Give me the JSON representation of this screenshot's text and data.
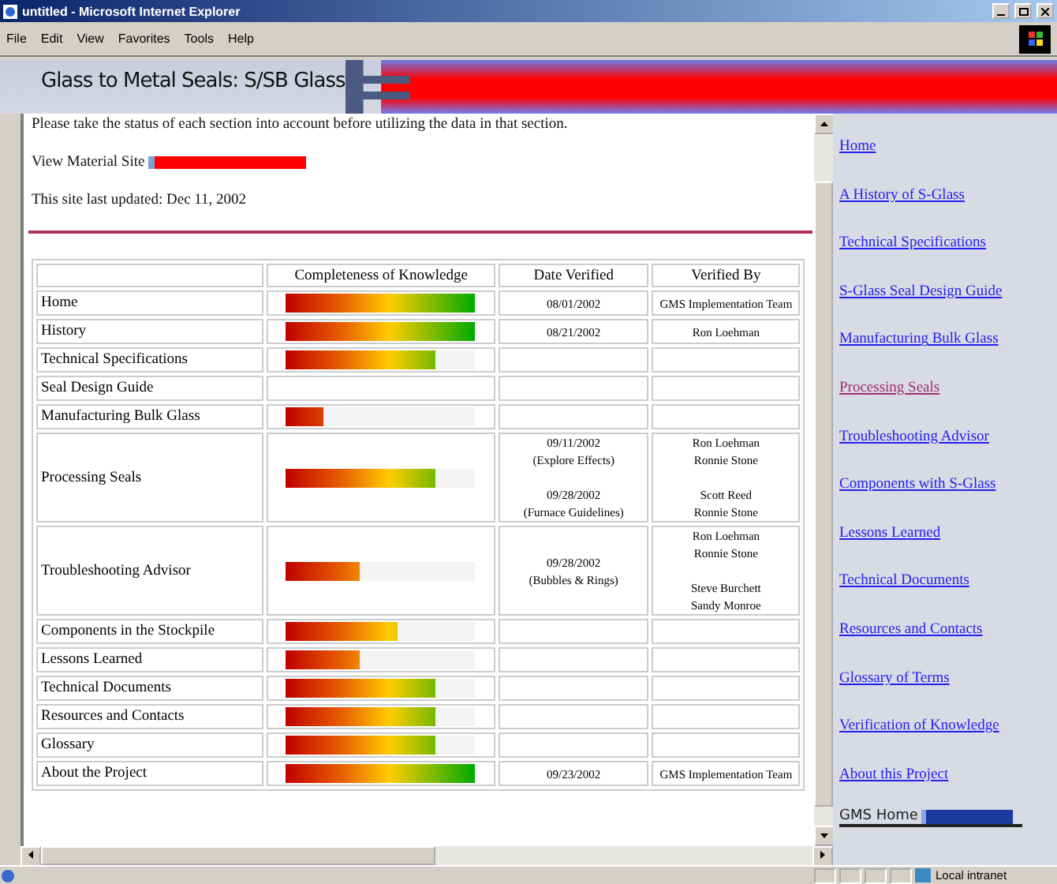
{
  "window": {
    "title": "untitled - Microsoft Internet Explorer"
  },
  "menu": [
    "File",
    "Edit",
    "View",
    "Favorites",
    "Tools",
    "Help"
  ],
  "banner": {
    "title": "Glass to Metal Seals: S/SB Glass"
  },
  "intro": [
    "Please take the status of each section into account before utilizing the data in that section.",
    "View Material Site",
    "This site last updated: Dec 11, 2002"
  ],
  "table": {
    "columns": [
      "Completeness of Knowledge",
      "Date Verified",
      "Verified By"
    ],
    "rows": [
      {
        "section": "Home",
        "level": 1,
        "dates": [
          [
            "08/01/2002"
          ]
        ],
        "verifiers": [
          [
            "GMS Implementation Team"
          ]
        ]
      },
      {
        "section": "History",
        "level": 1,
        "dates": [
          [
            "08/21/2002"
          ]
        ],
        "verifiers": [
          [
            "Ron Loehman"
          ]
        ]
      },
      {
        "section": "Technical Specifications",
        "level": 0.79,
        "dates": [],
        "verifiers": []
      },
      {
        "section": "Seal Design Guide",
        "dates": [],
        "verifiers": []
      },
      {
        "section": "Manufacturing Bulk Glass",
        "level": 0.2,
        "dates": [],
        "verifiers": []
      },
      {
        "section": "Processing Seals",
        "level": 0.79,
        "dates": [
          [
            "09/11/2002",
            "(Explore Effects)"
          ],
          [
            "09/28/2002",
            "(Furnace Guidelines)"
          ]
        ],
        "verifiers": [
          [
            "Ron Loehman",
            "Ronnie Stone"
          ],
          [
            "Scott Reed",
            "Ronnie Stone"
          ]
        ]
      },
      {
        "section": "Troubleshooting Advisor",
        "level": 0.39,
        "dates": [
          [
            "09/28/2002",
            "(Bubbles & Rings)"
          ]
        ],
        "verifiers": [
          [
            "Ron Loehman",
            "Ronnie Stone"
          ],
          [
            "Steve Burchett",
            "Sandy Monroe"
          ]
        ]
      },
      {
        "section": "Components in the Stockpile",
        "level": 0.59,
        "dates": [],
        "verifiers": []
      },
      {
        "section": "Lessons Learned",
        "level": 0.39,
        "dates": [],
        "verifiers": []
      },
      {
        "section": "Technical Documents",
        "level": 0.79,
        "dates": [],
        "verifiers": []
      },
      {
        "section": "Resources and Contacts",
        "level": 0.79,
        "dates": [],
        "verifiers": []
      },
      {
        "section": "Glossary",
        "level": 0.79,
        "dates": [],
        "verifiers": []
      },
      {
        "section": "About the Project",
        "level": 1,
        "dates": [
          [
            "09/23/2002"
          ]
        ],
        "verifiers": [
          [
            "GMS Implementation Team"
          ]
        ]
      }
    ]
  },
  "sidebar": {
    "links": [
      {
        "label": "Home",
        "visited": false
      },
      {
        "label": "A History of S-Glass",
        "visited": false
      },
      {
        "label": "Technical Specifications",
        "visited": false
      },
      {
        "label": "S-Glass Seal Design Guide",
        "visited": false
      },
      {
        "label": "Manufacturing Bulk Glass",
        "visited": false
      },
      {
        "label": "Processing Seals",
        "visited": true
      },
      {
        "label": "Troubleshooting Advisor",
        "visited": false
      },
      {
        "label": "Components with S-Glass",
        "visited": false
      },
      {
        "label": "Lessons Learned",
        "visited": false
      },
      {
        "label": "Technical Documents",
        "visited": false
      },
      {
        "label": "Resources and Contacts",
        "visited": false
      },
      {
        "label": "Glossary of Terms",
        "visited": false
      },
      {
        "label": "Verification of Knowledge",
        "visited": false
      },
      {
        "label": "About this Project",
        "visited": false
      }
    ],
    "home_link": "GMS Home"
  },
  "status_bar": {
    "zone": "Local intranet"
  }
}
